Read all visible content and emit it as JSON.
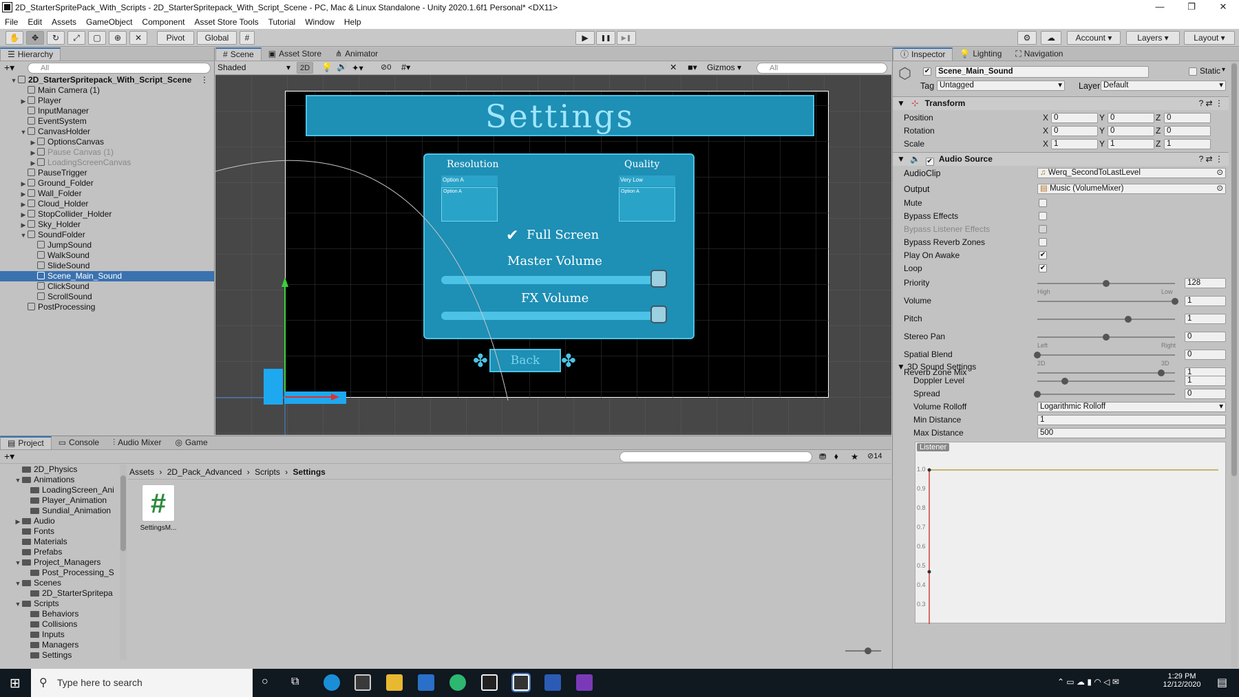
{
  "window": {
    "title": "2D_StarterSpritePack_With_Scripts - 2D_StarterSpritepack_With_Script_Scene - PC, Mac & Linux Standalone - Unity 2020.1.6f1 Personal* <DX11>",
    "minimize": "—",
    "restore": "❐",
    "close": "✕"
  },
  "menu": [
    "File",
    "Edit",
    "Assets",
    "GameObject",
    "Component",
    "Asset Store Tools",
    "Tutorial",
    "Window",
    "Help"
  ],
  "toolbar": {
    "pivot": "Pivot",
    "global": "Global",
    "play_icon": "▶",
    "pause_icon": "❚❚",
    "step_icon": "▶❚",
    "account": "Account",
    "layers": "Layers",
    "layout": "Layout"
  },
  "hierarchy": {
    "tab": "Hierarchy",
    "search_placeholder": "All",
    "items": [
      {
        "label": "2D_StarterSpritepack_With_Script_Scene",
        "indent": 0,
        "fold": "▼",
        "scene": true
      },
      {
        "label": "Main Camera (1)",
        "indent": 1,
        "fold": ""
      },
      {
        "label": "Player",
        "indent": 1,
        "fold": "▶"
      },
      {
        "label": "InputManager",
        "indent": 1,
        "fold": ""
      },
      {
        "label": "EventSystem",
        "indent": 1,
        "fold": ""
      },
      {
        "label": "CanvasHolder",
        "indent": 1,
        "fold": "▼"
      },
      {
        "label": "OptionsCanvas",
        "indent": 2,
        "fold": "▶"
      },
      {
        "label": "Pause Canvas (1)",
        "indent": 2,
        "fold": "▶",
        "dim": true
      },
      {
        "label": "LoadingScreenCanvas",
        "indent": 2,
        "fold": "▶",
        "dim": true
      },
      {
        "label": "PauseTrigger",
        "indent": 1,
        "fold": ""
      },
      {
        "label": "Ground_Folder",
        "indent": 1,
        "fold": "▶"
      },
      {
        "label": "Wall_Folder",
        "indent": 1,
        "fold": "▶"
      },
      {
        "label": "Cloud_Holder",
        "indent": 1,
        "fold": "▶"
      },
      {
        "label": "StopCollider_Holder",
        "indent": 1,
        "fold": "▶"
      },
      {
        "label": "Sky_Holder",
        "indent": 1,
        "fold": "▶"
      },
      {
        "label": "SoundFolder",
        "indent": 1,
        "fold": "▼"
      },
      {
        "label": "JumpSound",
        "indent": 2,
        "fold": ""
      },
      {
        "label": "WalkSound",
        "indent": 2,
        "fold": ""
      },
      {
        "label": "SlideSound",
        "indent": 2,
        "fold": ""
      },
      {
        "label": "Scene_Main_Sound",
        "indent": 2,
        "fold": "",
        "selected": true
      },
      {
        "label": "ClickSound",
        "indent": 2,
        "fold": ""
      },
      {
        "label": "ScrollSound",
        "indent": 2,
        "fold": ""
      },
      {
        "label": "PostProcessing",
        "indent": 1,
        "fold": ""
      }
    ]
  },
  "scene": {
    "tabs": [
      "Scene",
      "Asset Store",
      "Animator"
    ],
    "shading": "Shaded",
    "mode_2d": "2D",
    "hidden_count": "0",
    "gizmos": "Gizmos",
    "search_placeholder": "All",
    "settings_title": "Settings",
    "resolution_label": "Resolution",
    "quality_label": "Quality",
    "resolution_value": "Option A",
    "quality_value": "Very Low",
    "resolution_option": "Option A",
    "quality_option": "Option A",
    "fullscreen_label": "Full Screen",
    "master_volume_label": "Master Volume",
    "fx_volume_label": "FX Volume",
    "back_label": "Back"
  },
  "bottom": {
    "tabs": [
      "Project",
      "Console",
      "Audio Mixer",
      "Game"
    ],
    "count": "14",
    "folders": [
      {
        "label": "2D_Physics",
        "indent": 1,
        "fold": ""
      },
      {
        "label": "Animations",
        "indent": 1,
        "fold": "▼"
      },
      {
        "label": "LoadingScreen_Ani",
        "indent": 2,
        "fold": ""
      },
      {
        "label": "Player_Animation",
        "indent": 2,
        "fold": ""
      },
      {
        "label": "Sundial_Animation",
        "indent": 2,
        "fold": ""
      },
      {
        "label": "Audio",
        "indent": 1,
        "fold": "▶"
      },
      {
        "label": "Fonts",
        "indent": 1,
        "fold": ""
      },
      {
        "label": "Materials",
        "indent": 1,
        "fold": ""
      },
      {
        "label": "Prefabs",
        "indent": 1,
        "fold": ""
      },
      {
        "label": "Project_Managers",
        "indent": 1,
        "fold": "▼"
      },
      {
        "label": "Post_Processing_S",
        "indent": 2,
        "fold": ""
      },
      {
        "label": "Scenes",
        "indent": 1,
        "fold": "▼"
      },
      {
        "label": "2D_StarterSpritepa",
        "indent": 2,
        "fold": ""
      },
      {
        "label": "Scripts",
        "indent": 1,
        "fold": "▼"
      },
      {
        "label": "Behaviors",
        "indent": 2,
        "fold": ""
      },
      {
        "label": "Collisions",
        "indent": 2,
        "fold": ""
      },
      {
        "label": "Inputs",
        "indent": 2,
        "fold": ""
      },
      {
        "label": "Managers",
        "indent": 2,
        "fold": ""
      },
      {
        "label": "Settings",
        "indent": 2,
        "fold": ""
      }
    ],
    "breadcrumb": [
      "Assets",
      "2D_Pack_Advanced",
      "Scripts",
      "Settings"
    ],
    "asset_label": "SettingsM...",
    "asset_glyph": "#"
  },
  "inspector": {
    "tabs": [
      "Inspector",
      "Lighting",
      "Navigation"
    ],
    "object_name": "Scene_Main_Sound",
    "static_label": "Static",
    "tag_label": "Tag",
    "tag_value": "Untagged",
    "layer_label": "Layer",
    "layer_value": "Default",
    "transform": {
      "title": "Transform",
      "rows": [
        {
          "label": "Position",
          "x": "0",
          "y": "0",
          "z": "0"
        },
        {
          "label": "Rotation",
          "x": "0",
          "y": "0",
          "z": "0"
        },
        {
          "label": "Scale",
          "x": "1",
          "y": "1",
          "z": "1"
        }
      ]
    },
    "audio": {
      "title": "Audio Source",
      "audioclip_label": "AudioClip",
      "audioclip_value": "Werq_SecondToLastLevel",
      "output_label": "Output",
      "output_value": "Music (VolumeMixer)",
      "checks": [
        {
          "label": "Mute",
          "checked": false
        },
        {
          "label": "Bypass Effects",
          "checked": false
        },
        {
          "label": "Bypass Listener Effects",
          "checked": false,
          "dim": true
        },
        {
          "label": "Bypass Reverb Zones",
          "checked": false
        },
        {
          "label": "Play On Awake",
          "checked": true
        },
        {
          "label": "Loop",
          "checked": true
        }
      ],
      "sliders": [
        {
          "label": "Priority",
          "value": "128",
          "frac": 0.5,
          "left": "High",
          "right": "Low"
        },
        {
          "label": "Volume",
          "value": "1",
          "frac": 1.0
        },
        {
          "label": "Pitch",
          "value": "1",
          "frac": 0.66
        },
        {
          "label": "Stereo Pan",
          "value": "0",
          "frac": 0.5,
          "left": "Left",
          "right": "Right"
        },
        {
          "label": "Spatial Blend",
          "value": "0",
          "frac": 0.0,
          "left": "2D",
          "right": "3D"
        },
        {
          "label": "Reverb Zone Mix",
          "value": "1",
          "frac": 0.9
        }
      ],
      "sound3d_title": "3D Sound Settings",
      "doppler_label": "Doppler Level",
      "doppler_value": "1",
      "doppler_frac": 0.2,
      "spread_label": "Spread",
      "spread_value": "0",
      "spread_frac": 0.0,
      "rolloff_label": "Volume Rolloff",
      "rolloff_value": "Logarithmic Rolloff",
      "min_label": "Min Distance",
      "min_value": "1",
      "max_label": "Max Distance",
      "max_value": "500",
      "listener": "Listener",
      "graph_ticks": [
        "1.0",
        "0.9",
        "0.8",
        "0.7",
        "0.6",
        "0.5",
        "0.4",
        "0.3"
      ]
    }
  },
  "taskbar": {
    "search_placeholder": "Type here to search",
    "time": "1:29 PM",
    "date": "12/12/2020"
  },
  "colors": {
    "selection": "#3a72b0",
    "ui_teal": "#1e8fb5",
    "ui_teal_light": "#4cc3e6"
  }
}
